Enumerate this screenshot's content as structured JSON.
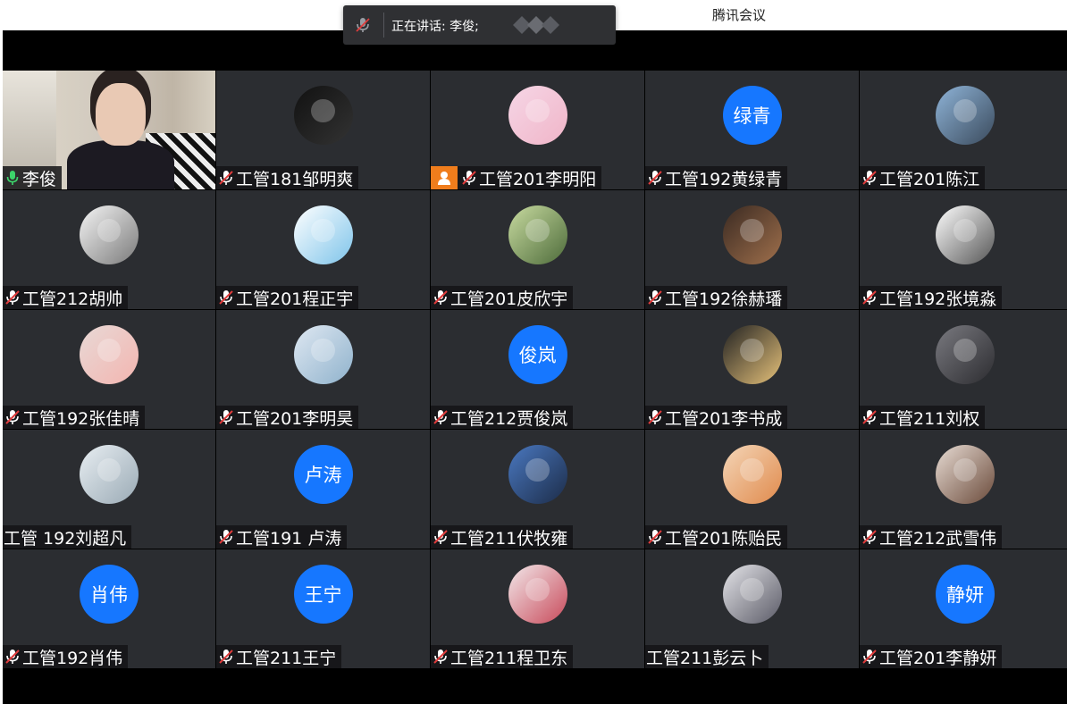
{
  "window": {
    "title": "腾讯会议"
  },
  "speaking_popup": {
    "text": "正在讲话: 李俊;"
  },
  "colors": {
    "tile_bg": "#2b2d31",
    "avatar_blue": "#1677ff",
    "mic_on": "#3cd46a",
    "mic_off": "#e03c3c",
    "self_border": "#3cb371"
  },
  "participants": [
    {
      "name": "李俊",
      "mic": "on",
      "avatar": "video",
      "self": true
    },
    {
      "name": "工管181邹明爽",
      "mic": "off",
      "avatar": "photo",
      "c1": "#111",
      "c2": "#333"
    },
    {
      "name": "工管201李明阳",
      "mic": "off",
      "avatar": "photo",
      "c1": "#f6d6e6",
      "c2": "#f0b5c8",
      "badge": "user-icon"
    },
    {
      "name": "工管192黄绿青",
      "mic": "off",
      "avatar": "text",
      "avatar_text": "绿青"
    },
    {
      "name": "工管201陈江",
      "mic": "off",
      "avatar": "photo",
      "c1": "#8fb4d8",
      "c2": "#3a4a5c"
    },
    {
      "name": "工管212胡帅",
      "mic": "off",
      "avatar": "photo",
      "c1": "#f5f5f5",
      "c2": "#7a7a7a"
    },
    {
      "name": "工管201程正宇",
      "mic": "off",
      "avatar": "photo",
      "c1": "#ffffff",
      "c2": "#7ec4ea"
    },
    {
      "name": "工管201皮欣宇",
      "mic": "off",
      "avatar": "photo",
      "c1": "#c8dba0",
      "c2": "#4d6b3a"
    },
    {
      "name": "工管192徐赫璠",
      "mic": "off",
      "avatar": "photo",
      "c1": "#3a2a22",
      "c2": "#a0704c"
    },
    {
      "name": "工管192张境淼",
      "mic": "off",
      "avatar": "photo",
      "c1": "#ffffff",
      "c2": "#555"
    },
    {
      "name": "工管192张佳晴",
      "mic": "off",
      "avatar": "photo",
      "c1": "#e8d9d6",
      "c2": "#f3b5b0"
    },
    {
      "name": "工管201李明昊",
      "mic": "off",
      "avatar": "photo",
      "c1": "#dfe8f2",
      "c2": "#8fb2cc"
    },
    {
      "name": "工管212贾俊岚",
      "mic": "off",
      "avatar": "text",
      "avatar_text": "俊岚"
    },
    {
      "name": "工管201李书成",
      "mic": "off",
      "avatar": "photo",
      "c1": "#222",
      "c2": "#e6c27a"
    },
    {
      "name": "工管211刘权",
      "mic": "off",
      "avatar": "photo",
      "c1": "#7a7a80",
      "c2": "#2c2c30"
    },
    {
      "name": "工管 192刘超凡",
      "mic": "none",
      "avatar": "photo",
      "c1": "#e8eef2",
      "c2": "#9aaab5"
    },
    {
      "name": "工管191 卢涛",
      "mic": "off",
      "avatar": "text",
      "avatar_text": "卢涛"
    },
    {
      "name": "工管211伏牧雍",
      "mic": "off",
      "avatar": "photo",
      "c1": "#4a78c0",
      "c2": "#1c2c48"
    },
    {
      "name": "工管201陈贻民",
      "mic": "off",
      "avatar": "photo",
      "c1": "#f4d6b8",
      "c2": "#e08a4c"
    },
    {
      "name": "工管212武雪伟",
      "mic": "off",
      "avatar": "photo",
      "c1": "#e8dcd4",
      "c2": "#6a4a3a"
    },
    {
      "name": "工管192肖伟",
      "mic": "off",
      "avatar": "text",
      "avatar_text": "肖伟"
    },
    {
      "name": "工管211王宁",
      "mic": "off",
      "avatar": "text",
      "avatar_text": "王宁"
    },
    {
      "name": "工管211程卫东",
      "mic": "off",
      "avatar": "photo",
      "c1": "#f2e8ea",
      "c2": "#c84a5a"
    },
    {
      "name": "工管211彭云卜",
      "mic": "none",
      "avatar": "photo",
      "c1": "#e4e4e8",
      "c2": "#5a5a66"
    },
    {
      "name": "工管201李静妍",
      "mic": "off",
      "avatar": "text",
      "avatar_text": "静妍"
    }
  ]
}
